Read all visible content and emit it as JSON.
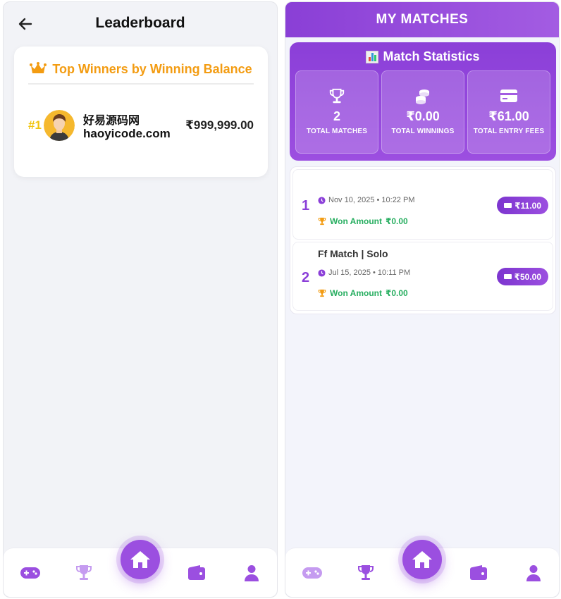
{
  "leaderboard": {
    "title": "Leaderboard",
    "section_title": "Top Winners by Winning Balance",
    "winners": [
      {
        "rank": "#1",
        "name_line1": "好易源码网",
        "name_line2": "haoyicode.com",
        "balance": "₹999,999.00"
      }
    ]
  },
  "my_matches": {
    "title": "MY MATCHES",
    "stats_title": "Match Statistics",
    "stats": [
      {
        "icon": "trophy-icon",
        "value": "2",
        "label": "TOTAL MATCHES"
      },
      {
        "icon": "coins-icon",
        "value": "₹0.00",
        "label": "TOTAL WINNINGS"
      },
      {
        "icon": "credit-card-icon",
        "value": "₹61.00",
        "label": "TOTAL ENTRY FEES"
      }
    ],
    "matches": [
      {
        "index": "1",
        "title": "",
        "date": "Nov 10, 2025 • 10:22 PM",
        "won_label": "Won Amount",
        "won_value": "₹0.00",
        "fee": "₹11.00"
      },
      {
        "index": "2",
        "title": "Ff Match | Solo",
        "date": "Jul 15, 2025 • 10:11 PM",
        "won_label": "Won Amount",
        "won_value": "₹0.00",
        "fee": "₹50.00"
      }
    ]
  },
  "nav": {
    "items": [
      "gamepad-icon",
      "trophy-icon",
      "home-icon",
      "wallet-icon",
      "user-icon"
    ]
  },
  "colors": {
    "accent": "#8b3fd8",
    "gold": "#f39c12",
    "green": "#27ae60"
  }
}
